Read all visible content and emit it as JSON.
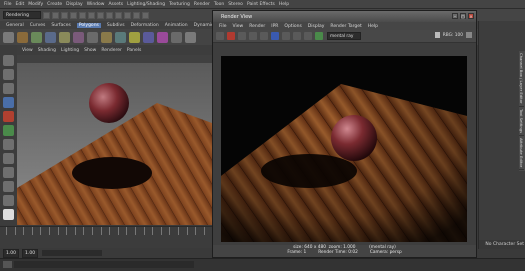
{
  "maya": {
    "menubar": [
      "File",
      "Edit",
      "Modify",
      "Create",
      "Display",
      "Window",
      "Assets",
      "Lighting/Shading",
      "Texturing",
      "Render",
      "Toon",
      "Stereo",
      "Paint Effects",
      "Help"
    ],
    "mode": "Rendering",
    "shelf_tabs": [
      "General",
      "Curves",
      "Surfaces",
      "Polygons",
      "Subdivs",
      "Deformation",
      "Animation",
      "Dynamics"
    ],
    "active_shelf_tab": "Polygons",
    "viewport_menu": [
      "View",
      "Shading",
      "Lighting",
      "Show",
      "Renderer",
      "Panels"
    ],
    "range_start": "1.00",
    "range_current": "1.00",
    "character_set": "No Character Set",
    "right_tabs": [
      "Channel Box / Layer Editor",
      "Tool Settings",
      "Attribute Editor"
    ]
  },
  "render_view": {
    "title": "Render View",
    "menubar": [
      "File",
      "View",
      "Render",
      "IPR",
      "Options",
      "Display",
      "Render Target",
      "Help"
    ],
    "renderer": "mental ray",
    "toolbar_right_label": "RBG: 100",
    "status_line1": "size: 640 x 480  zoom: 1.000          (mental ray)",
    "frame_label": "Frame: 1",
    "render_time_label": "Render Time: 0:02",
    "camera_label": "Camera: persp"
  },
  "colors": {
    "wood": "#8a4a22",
    "sphere": "#7a2a30",
    "accent": "#5a7bb0"
  }
}
